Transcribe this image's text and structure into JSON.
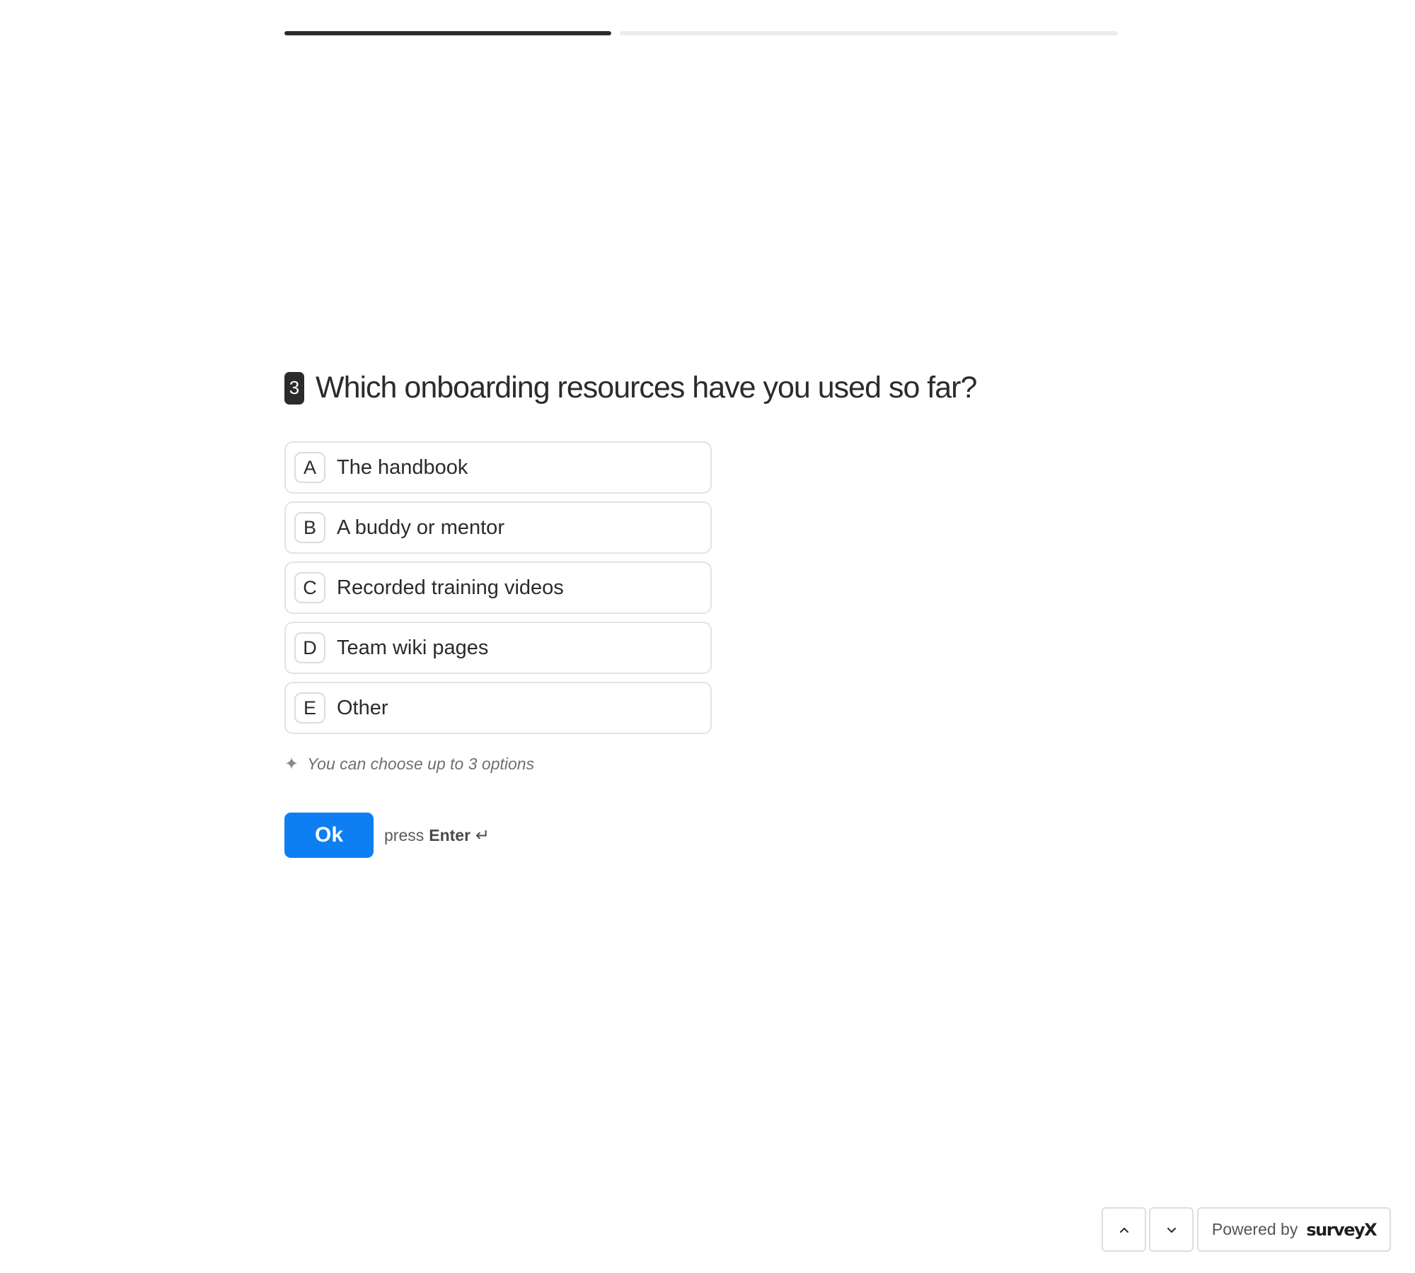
{
  "progress": {
    "segments": [
      {
        "fraction": 1.0
      },
      {
        "fraction": 0.0
      }
    ]
  },
  "question": {
    "number": "3",
    "title": "Which onboarding resources have you used so far?"
  },
  "options": [
    {
      "key": "A",
      "label": "The handbook"
    },
    {
      "key": "B",
      "label": "A buddy or mentor"
    },
    {
      "key": "C",
      "label": "Recorded training videos"
    },
    {
      "key": "D",
      "label": "Team wiki pages"
    },
    {
      "key": "E",
      "label": "Other"
    }
  ],
  "hint": {
    "text": "You can choose up to 3 options",
    "icon": "sparkle-icon"
  },
  "submit": {
    "button_label": "Ok",
    "press_label": "press",
    "key_label": "Enter",
    "key_icon": "enter-icon"
  },
  "footer": {
    "prev_icon": "chevron-up-icon",
    "next_icon": "chevron-down-icon",
    "powered_by": "Powered by",
    "brand": "surveyX"
  },
  "colors": {
    "accent": "#0d7ff2",
    "text": "#2b2b2b",
    "progress_filled": "#2b2b2b",
    "progress_track": "#ececec",
    "border": "#e3e3e3"
  }
}
